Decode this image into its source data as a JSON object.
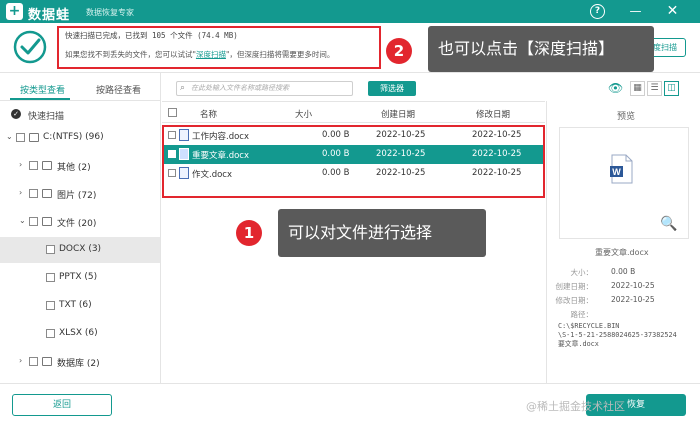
{
  "titlebar": {
    "logo_glyph": "+",
    "app_name": "数据蛙",
    "subtitle": "数据恢复专家",
    "help_glyph": "?",
    "min_glyph": "—",
    "close_glyph": "✕"
  },
  "scan_info": {
    "line1": "快速扫描已完成，已找到 105 个文件 (74.4 MB)",
    "line2_prefix": "如果您找不到丢失的文件，您可以试试\"",
    "line2_link": "深度扫描",
    "line2_suffix": "\"，但深度扫描将需要更多时间。",
    "deep_scan_button": "深度扫描"
  },
  "callouts": {
    "c2_number": "2",
    "c2_text": "也可以点击【深度扫描】",
    "c1_number": "1",
    "c1_text": "可以对文件进行选择"
  },
  "left_pane": {
    "tab_type": "按类型查看",
    "tab_path": "按路径查看",
    "scan_mode": "快速扫描",
    "tree": [
      {
        "label": "C:(NTFS) (96)",
        "arrow": "⌄"
      },
      {
        "label": "其他 (2)",
        "arrow": "›"
      },
      {
        "label": "图片 (72)",
        "arrow": "›"
      },
      {
        "label": "文件 (20)",
        "arrow": "⌄"
      },
      {
        "label": "DOCX (3)"
      },
      {
        "label": "PPTX (5)"
      },
      {
        "label": "TXT (6)"
      },
      {
        "label": "XLSX (6)"
      },
      {
        "label": "数据库 (2)",
        "arrow": "›"
      }
    ]
  },
  "toolbar": {
    "search_placeholder": "在此处输入文件名称或路径搜索",
    "filter_button": "筛选器",
    "eye_glyph": "👁",
    "view_grid_glyph": "▦",
    "view_list_glyph": "☰",
    "view_detail_glyph": "◫"
  },
  "file_table": {
    "headers": {
      "name": "名称",
      "size": "大小",
      "created": "创建日期",
      "modified": "修改日期"
    },
    "rows": [
      {
        "name": "工作内容.docx",
        "size": "0.00 B",
        "created": "2022-10-25",
        "modified": "2022-10-25"
      },
      {
        "name": "重要文章.docx",
        "size": "0.00 B",
        "created": "2022-10-25",
        "modified": "2022-10-25"
      },
      {
        "name": "作文.docx",
        "size": "0.00 B",
        "created": "2022-10-25",
        "modified": "2022-10-25"
      }
    ]
  },
  "preview": {
    "title": "预览",
    "file_name": "重要文章.docx",
    "size_label": "大小：",
    "size_value": "0.00 B",
    "created_label": "创建日期：",
    "created_value": "2022-10-25",
    "modified_label": "修改日期：",
    "modified_value": "2022-10-25",
    "path_label": "路径：",
    "path_line1": "C:\\$RECYCLE.BIN",
    "path_line2": "\\S-1-5-21-2588024625-37382524",
    "path_line3": "要文章.docx",
    "word_letter": "W",
    "magnifier_glyph": "🔍"
  },
  "bottom": {
    "back_button": "返回",
    "recover_button": "恢复",
    "watermark": "@稀土掘金技术社区"
  },
  "colors": {
    "accent": "#13998f",
    "highlight_red": "#e2262e",
    "callout_gray": "#5a5a5a"
  }
}
